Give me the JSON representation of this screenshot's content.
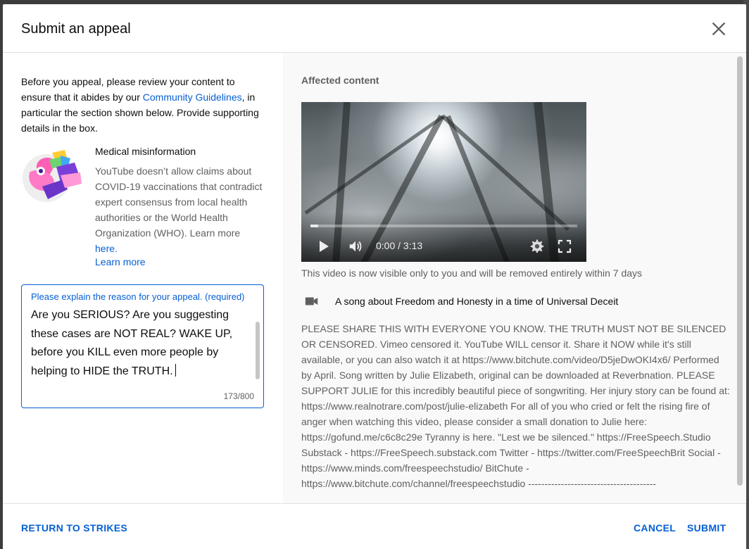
{
  "dialog": {
    "title": "Submit an appeal",
    "close_icon": "close-icon"
  },
  "intro": {
    "text_before": "Before you appeal, please review your content to ensure that it abides by our ",
    "guidelines_link": "Community Guidelines",
    "text_after": ", in particular the section shown below. Provide supporting details in the box."
  },
  "policy": {
    "illustration": "medical-misinformation-illustration",
    "title": "Medical misinformation",
    "description": "YouTube doesn’t allow claims about COVID-19 vaccinations that contradict expert consensus from local health authorities or the World Health Organization (WHO). Learn more ",
    "here_link": "here",
    "period": ".",
    "learn_more": "Learn more"
  },
  "appeal": {
    "label": "Please explain the reason for your appeal. (required)",
    "value": "Are you SERIOUS? Are you suggesting these cases are NOT REAL? WAKE UP, before you KILL even more people by helping to HIDE the TRUTH.",
    "char_count": "173/800"
  },
  "affected": {
    "section_title": "Affected content",
    "player": {
      "progress": 0.03,
      "time": "0:00 / 3:13",
      "icons": [
        "play-icon",
        "volume-icon",
        "settings-icon",
        "fullscreen-icon"
      ]
    },
    "visibility_note": "This video is now visible only to you and will be removed entirely within 7 days",
    "video_icon": "video-camera-icon",
    "video_title": "A song about Freedom and Honesty in a time of Universal Deceit",
    "description": "PLEASE SHARE THIS WITH EVERYONE YOU KNOW. THE TRUTH MUST NOT BE SILENCED OR CENSORED. Vimeo censored it. YouTube WILL censor it. Share it NOW while it's still available, or you can also watch it at https://www.bitchute.com/video/D5jeDwOKI4x6/ Performed by April. Song written by Julie Elizabeth, original can be downloaded at Reverbnation. PLEASE SUPPORT JULIE for this incredibly beautiful piece of songwriting. Her injury story can be found at: https://www.realnotrare.com/post/julie-elizabeth For all of you who cried or felt the rising fire of anger when watching this video, please consider a small donation to Julie here: https://gofund.me/c6c8c29e Tyranny is here. \"Lest we be silenced.\" https://FreeSpeech.Studio Substack - https://FreeSpeech.substack.com Twitter - https://twitter.com/FreeSpeechBrit Social - https://www.minds.com/freespeechstudio/ BitChute - https://www.bitchute.com/channel/freespeechstudio ---------------------------------------"
  },
  "footer": {
    "return_label": "RETURN TO STRIKES",
    "cancel_label": "CANCEL",
    "submit_label": "SUBMIT"
  },
  "colors": {
    "accent": "#065fd4",
    "secondary_text": "#606060",
    "right_panel_bg": "#f9f9f9"
  }
}
